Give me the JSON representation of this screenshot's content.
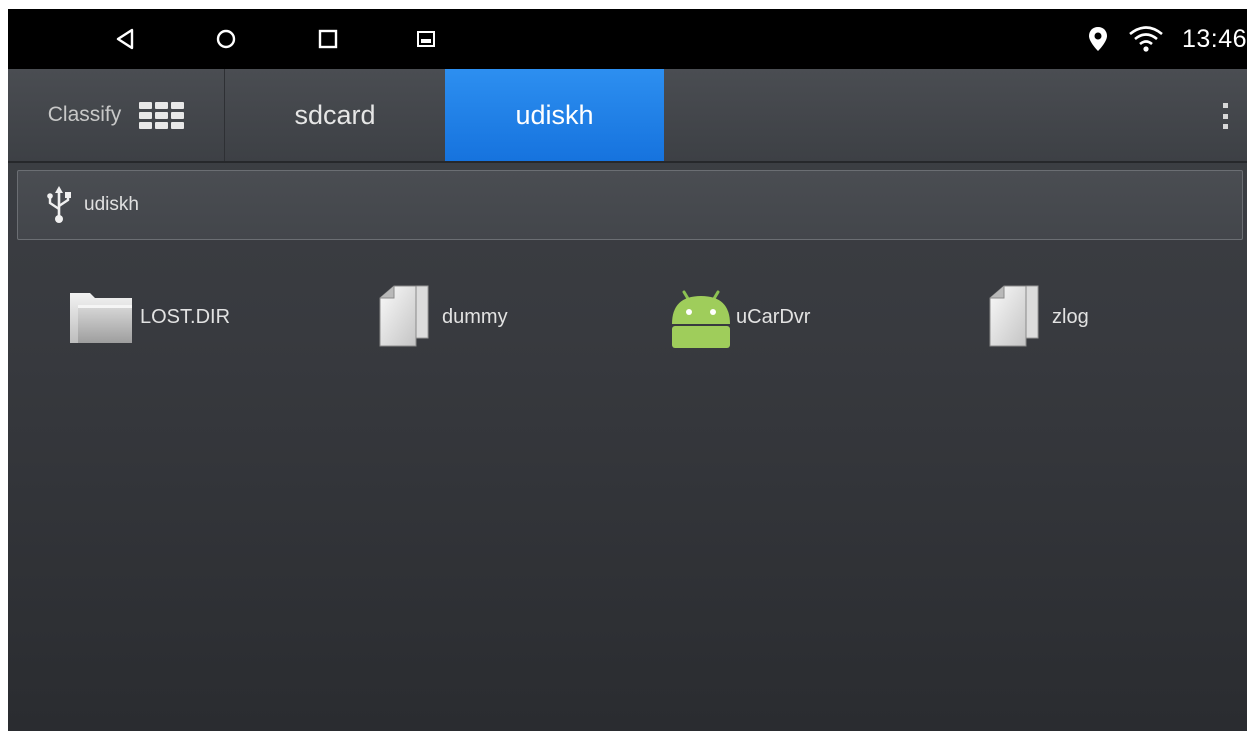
{
  "status_bar": {
    "nav": [
      "back-icon",
      "home-icon",
      "recents-icon",
      "screenshot-icon"
    ],
    "indicators": [
      "location-icon",
      "wifi-icon"
    ],
    "time": "13:46"
  },
  "tabs": {
    "classify_label": "Classify",
    "items": [
      {
        "label": "sdcard",
        "active": false
      },
      {
        "label": "udiskh",
        "active": true
      }
    ],
    "accent_color": "#1a7ee6"
  },
  "path_bar": {
    "icon": "usb-icon",
    "path": "udiskh"
  },
  "files": [
    {
      "name": "LOST.DIR",
      "type": "folder",
      "icon": "folder-icon"
    },
    {
      "name": "dummy",
      "type": "file",
      "icon": "file-icon"
    },
    {
      "name": "uCarDvr",
      "type": "apk",
      "icon": "android-icon"
    },
    {
      "name": "zlog",
      "type": "file",
      "icon": "file-icon"
    }
  ]
}
